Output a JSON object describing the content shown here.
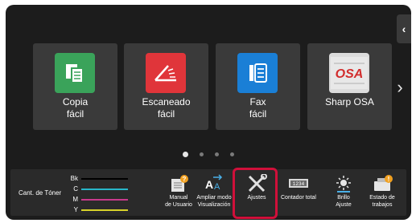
{
  "apps": [
    {
      "label": "Copia\nfácil",
      "icon": "copy-icon",
      "color": "#3aa35a"
    },
    {
      "label": "Escaneado\nfácil",
      "icon": "scan-icon",
      "color": "#e0353a"
    },
    {
      "label": "Fax\nfácil",
      "icon": "fax-icon",
      "color": "#1a7fd6"
    },
    {
      "label": "Sharp OSA",
      "icon": "sharp-osa-icon",
      "color": "#dcdcdc"
    }
  ],
  "pagination": {
    "pages": 4,
    "current": 1
  },
  "toner": {
    "title": "Cant. de Tóner",
    "levels": [
      {
        "letter": "Bk",
        "color": "#111111"
      },
      {
        "letter": "C",
        "color": "#28b7c9"
      },
      {
        "letter": "M",
        "color": "#c83a8c"
      },
      {
        "letter": "Y",
        "color": "#d8d22a"
      }
    ]
  },
  "functions": [
    {
      "label": "Manual\nde Usuario",
      "icon": "user-manual-icon"
    },
    {
      "label": "Ampliar modo\nVisualización",
      "icon": "enlarge-display-icon"
    },
    {
      "label": "Ajustes",
      "icon": "settings-tools-icon",
      "highlighted": true
    },
    {
      "label": "Contador total",
      "icon": "total-counter-icon"
    },
    {
      "label": "Brillo\nAjuste",
      "icon": "brightness-icon"
    },
    {
      "label": "Estado de\ntrabajos",
      "icon": "job-status-icon"
    }
  ],
  "highlight_color": "#d0103a"
}
